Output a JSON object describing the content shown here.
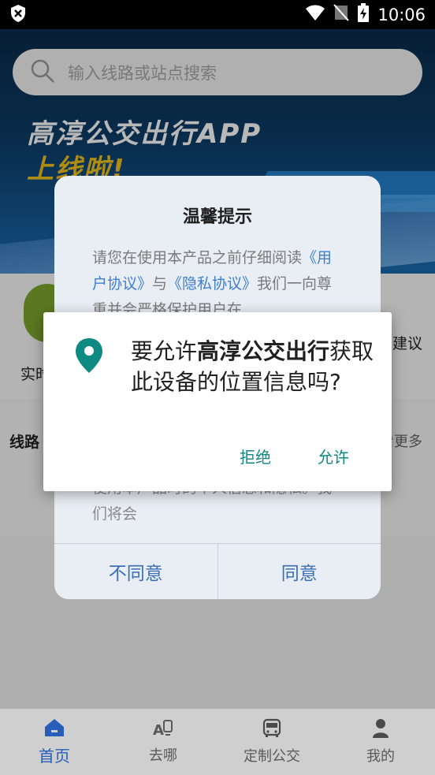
{
  "status_bar": {
    "time": "10:06",
    "icons": [
      "shield-icon",
      "wifi-icon",
      "no-sim-icon",
      "battery-charging-icon"
    ]
  },
  "banner": {
    "line1": "高淳公交出行APP",
    "line2": "上线啦!"
  },
  "search": {
    "placeholder": "输入线路或站点搜索",
    "icon": "search-icon"
  },
  "quick_nav": {
    "left_label": "实时",
    "right_label": "建议"
  },
  "lines_section": {
    "title": "线路",
    "more": "看更多"
  },
  "notice_dialog": {
    "title": "温馨提示",
    "body_part1": "请您在使用本产品之前仔细阅读",
    "user_agreement": "《用户协议》",
    "conjunction": "与",
    "privacy_policy": "《隐私协议》",
    "body_part2": "我们一向尊重并会严格保护用户在",
    "body_tail": "使用本产品时的个人信息和隐私。我们将会",
    "disagree": "不同意",
    "agree": "同意"
  },
  "permission_dialog": {
    "icon": "location-pin-icon",
    "prefix": "要允许",
    "app_name": "高淳公交出行",
    "suffix": "获取此设备的位置信息吗?",
    "deny": "拒绝",
    "allow": "允许",
    "accent": "#0f8a83"
  },
  "bottom_nav": {
    "items": [
      {
        "label": "首页",
        "icon": "home-icon",
        "active": true
      },
      {
        "label": "去哪",
        "icon": "route-icon",
        "active": false
      },
      {
        "label": "定制公交",
        "icon": "bus-icon",
        "active": false
      },
      {
        "label": "我的",
        "icon": "user-icon",
        "active": false
      }
    ]
  }
}
